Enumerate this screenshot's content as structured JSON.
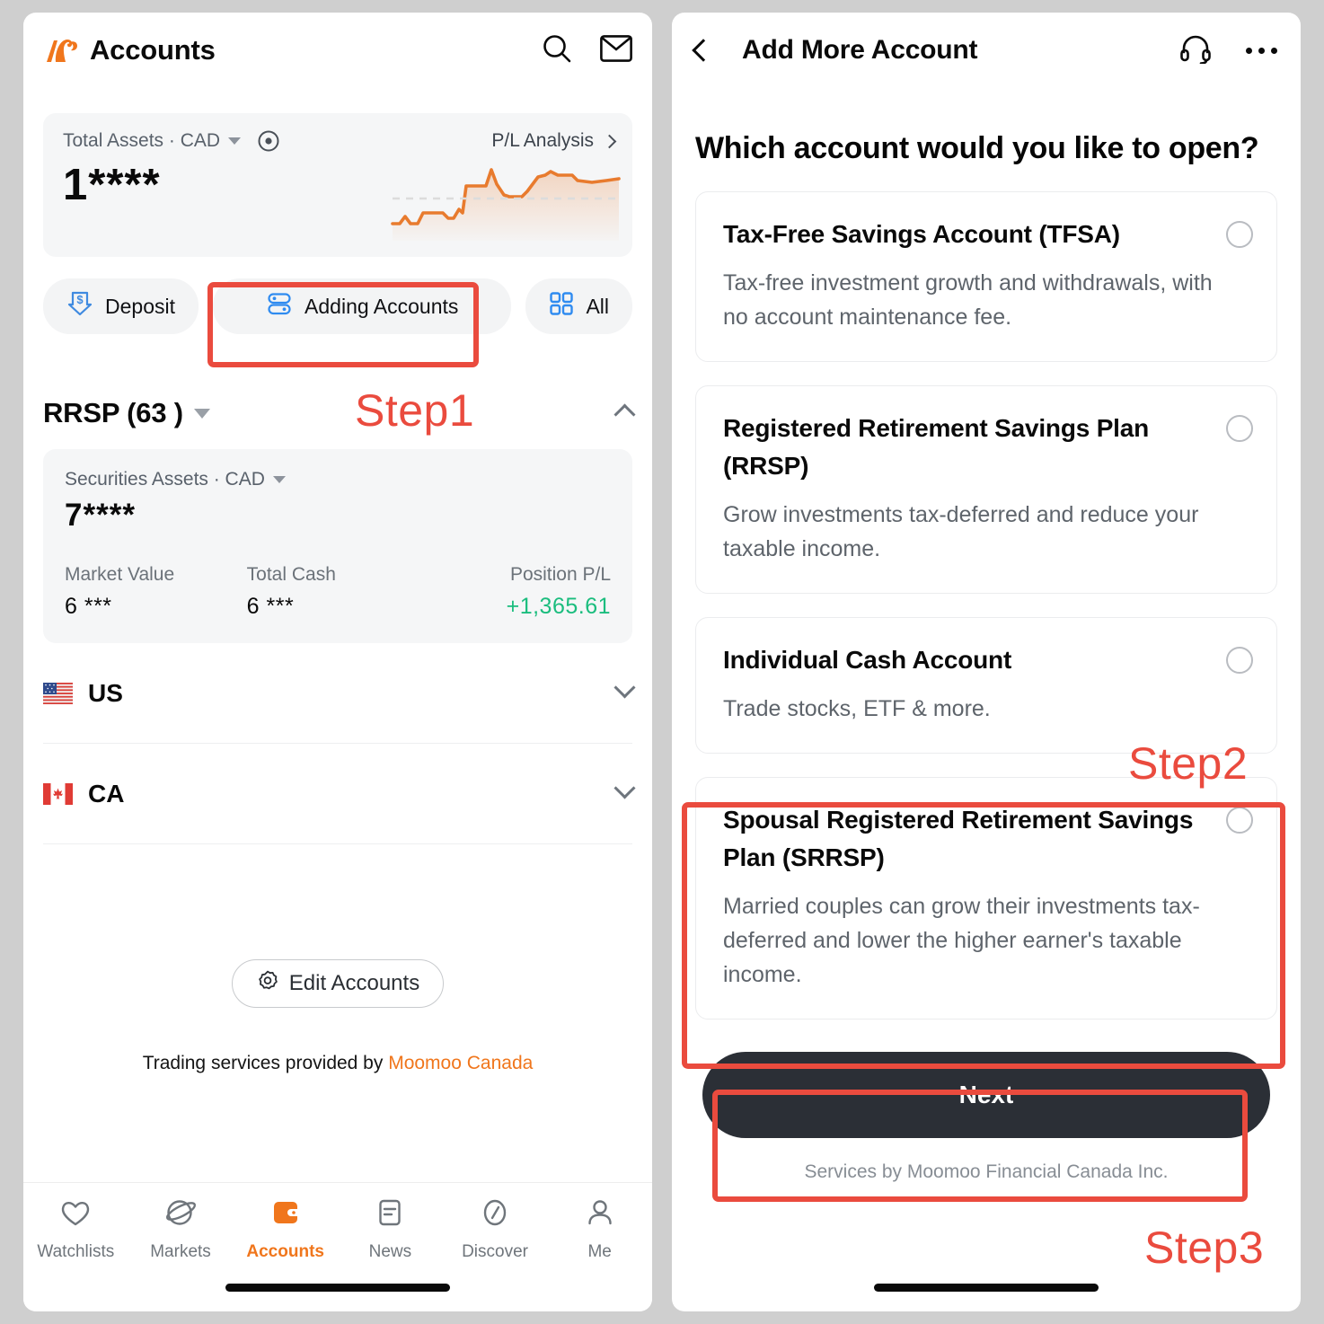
{
  "accounts_screen": {
    "header": {
      "title": "Accounts",
      "logo_icon": "moomoo-bull-logo",
      "search_icon": "search-icon",
      "mail_icon": "mail-icon"
    },
    "total_assets_card": {
      "label": "Total Assets · CAD",
      "currency_caret_icon": "chevron-down-icon",
      "eye_icon": "eye-icon",
      "pl_link_label": "P/L Analysis",
      "pl_link_chevron_icon": "chevron-right-icon",
      "value": "1****",
      "sparkline_icon": "sparkline-chart",
      "sparkline_color": "#ea7f35"
    },
    "quick_actions": [
      {
        "label": "Deposit",
        "icon": "deposit-arrow-icon"
      },
      {
        "label": "Adding Accounts",
        "icon": "stacked-accounts-icon"
      },
      {
        "label": "All",
        "icon": "grid-icon"
      }
    ],
    "group": {
      "title": "RRSP (63  )",
      "title_caret_icon": "chevron-down-icon",
      "collapse_icon": "chevron-up-icon",
      "securities": {
        "label": "Securities Assets · CAD",
        "currency_caret_icon": "chevron-down-icon",
        "value": "7****",
        "stats": [
          {
            "key": "Market Value",
            "value": "6 ***"
          },
          {
            "key": "Total Cash",
            "value": "6 ***"
          },
          {
            "key": "Position P/L",
            "value": "+1,365.61",
            "positive": true
          }
        ]
      },
      "countries": [
        {
          "name": "US",
          "flag": "us-flag-icon",
          "chevron_icon": "chevron-down-icon"
        },
        {
          "name": "CA",
          "flag": "ca-flag-icon",
          "chevron_icon": "chevron-down-icon"
        }
      ]
    },
    "edit_accounts": {
      "label": "Edit Accounts",
      "icon": "gear-icon"
    },
    "footnote": {
      "prefix": "Trading services provided by ",
      "brand": "Moomoo Canada",
      "brand_color": "#f0761c"
    },
    "tabbar": [
      {
        "label": "Watchlists",
        "icon": "heart-icon",
        "active": false
      },
      {
        "label": "Markets",
        "icon": "planet-icon",
        "active": false
      },
      {
        "label": "Accounts",
        "icon": "wallet-icon",
        "active": true
      },
      {
        "label": "News",
        "icon": "news-icon",
        "active": false
      },
      {
        "label": "Discover",
        "icon": "compass-icon",
        "active": false
      },
      {
        "label": "Me",
        "icon": "person-icon",
        "active": false
      }
    ]
  },
  "add_account_screen": {
    "header": {
      "back_icon": "chevron-left-icon",
      "title": "Add More Account",
      "support_icon": "headset-icon",
      "more_icon": "more-horizontal-icon"
    },
    "question": "Which account would you like to open?",
    "options": [
      {
        "title": "Tax-Free Savings Account (TFSA)",
        "description": "Tax-free investment growth and withdrawals, with no account maintenance fee.",
        "radio_icon": "radio-unselected-icon",
        "selected": false
      },
      {
        "title": "Registered Retirement Savings Plan (RRSP)",
        "description": "Grow investments tax-deferred and reduce your taxable income.",
        "radio_icon": "radio-unselected-icon",
        "selected": false
      },
      {
        "title": "Individual Cash Account",
        "description": "Trade stocks, ETF & more.",
        "radio_icon": "radio-unselected-icon",
        "selected": false
      },
      {
        "title": "Spousal Registered Retirement Savings Plan (SRRSP)",
        "description": "Married couples can grow their investments tax-deferred and lower the higher earner's taxable income.",
        "radio_icon": "radio-unselected-icon",
        "selected": false
      }
    ],
    "next_button": "Next",
    "services_note": "Services by Moomoo Financial Canada Inc."
  },
  "annotations": {
    "color": "#ea4b3e",
    "steps": [
      {
        "label": "Step1"
      },
      {
        "label": "Step2"
      },
      {
        "label": "Step3"
      }
    ]
  }
}
